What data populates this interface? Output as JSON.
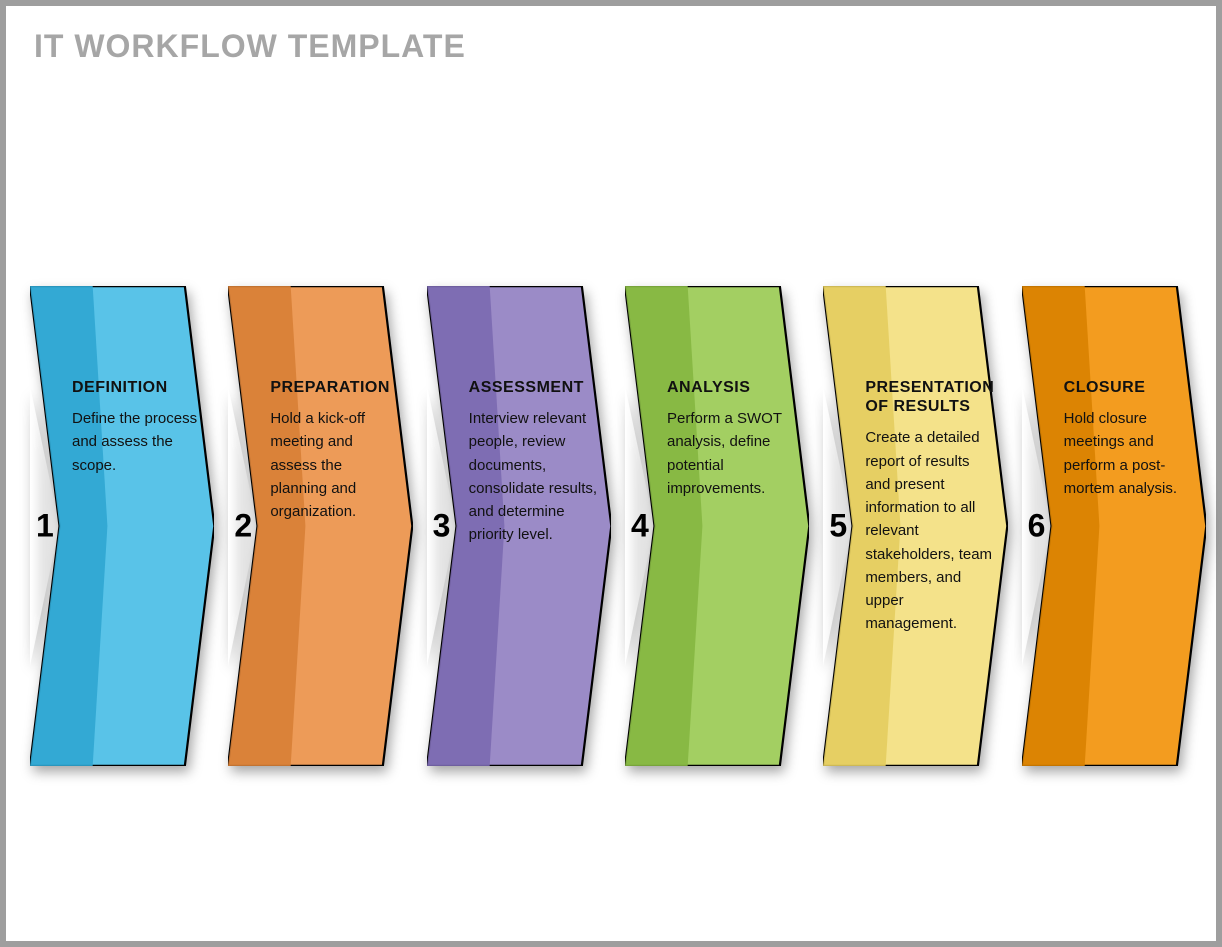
{
  "title": "IT WORKFLOW TEMPLATE",
  "steps": [
    {
      "num": "1",
      "heading": "DEFINITION",
      "desc": "Define the process and assess the scope.",
      "fill": "#59c3e8",
      "shade": "#2fa6d1"
    },
    {
      "num": "2",
      "heading": "PREPARATION",
      "desc": "Hold a kick-off meeting and assess the planning and organization.",
      "fill": "#ed9b58",
      "shade": "#d77f36"
    },
    {
      "num": "3",
      "heading": "ASSESSMENT",
      "desc": "Interview relevant people, review documents, consolidate results, and determine priority level.",
      "fill": "#9b8bc7",
      "shade": "#7b69b0"
    },
    {
      "num": "4",
      "heading": "ANALYSIS",
      "desc": "Perform a SWOT analysis, define potential improvements.",
      "fill": "#a3cf62",
      "shade": "#85b641"
    },
    {
      "num": "5",
      "heading": "PRESENTATION OF RESULTS",
      "desc": "Create a detailed report of results and present information to all relevant stakeholders, team members, and upper management.",
      "fill": "#f4e28a",
      "shade": "#e4cd5e"
    },
    {
      "num": "6",
      "heading": "CLOSURE",
      "desc": "Hold closure meetings and perform a post-mortem analysis.",
      "fill": "#f39c1f",
      "shade": "#d98200"
    }
  ]
}
